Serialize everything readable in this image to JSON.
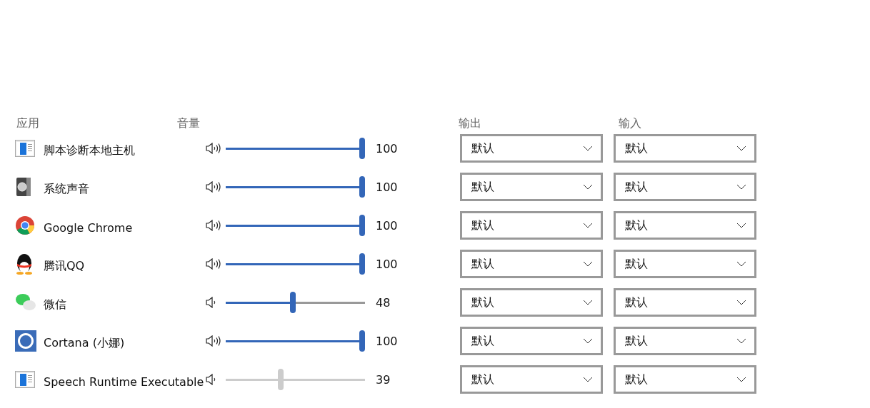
{
  "headers": {
    "app": "应用",
    "volume": "音量",
    "output": "输出",
    "input": "输入"
  },
  "channels": [
    {
      "name": "脚本诊断本地主机",
      "level": 1.0,
      "reading": "100",
      "disabled": false,
      "output": "默认",
      "input": "默认"
    },
    {
      "name": "系统声音",
      "level": 1.0,
      "reading": "100",
      "disabled": false,
      "output": "默认",
      "input": "默认"
    },
    {
      "name": "Google Chrome",
      "level": 1.0,
      "reading": "100",
      "disabled": false,
      "output": "默认",
      "input": "默认"
    },
    {
      "name": "腾讯QQ",
      "level": 1.0,
      "reading": "100",
      "disabled": false,
      "output": "默认",
      "input": "默认"
    },
    {
      "name": "微信",
      "level": 0.48,
      "reading": "48",
      "disabled": false,
      "output": "默认",
      "input": "默认"
    },
    {
      "name": "Cortana (小娜)",
      "level": 1.0,
      "reading": "100",
      "disabled": false,
      "output": "默认",
      "input": "默认"
    },
    {
      "name": "Speech Runtime Executable",
      "level": 0.39,
      "reading": "39",
      "disabled": true,
      "output": "默认",
      "input": "默认"
    }
  ]
}
